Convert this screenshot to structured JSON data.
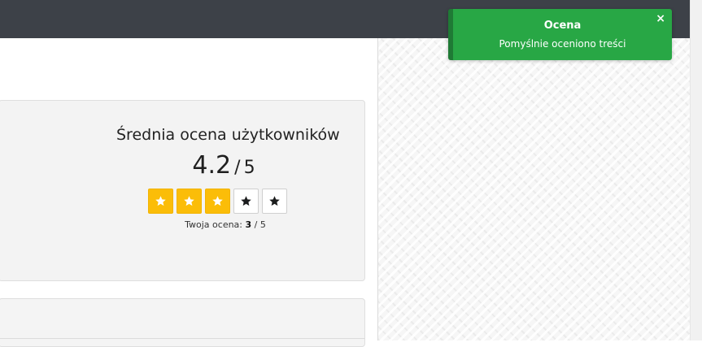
{
  "rating": {
    "title": "Średnia ocena użytkowników",
    "average": "4.2",
    "separator": "/",
    "max": "5",
    "stars": [
      {
        "filled": true
      },
      {
        "filled": true
      },
      {
        "filled": true
      },
      {
        "filled": false
      },
      {
        "filled": false
      }
    ],
    "your_rating_label": "Twoja ocena:",
    "your_rating_value": "3",
    "your_rating_max": "/ 5"
  },
  "toast": {
    "title": "Ocena",
    "message": "Pomyślnie oceniono treści",
    "close_icon": "×"
  },
  "colors": {
    "topbar": "#3d4148",
    "star_filled": "#fbbd08",
    "toast_bg": "#28a745"
  }
}
